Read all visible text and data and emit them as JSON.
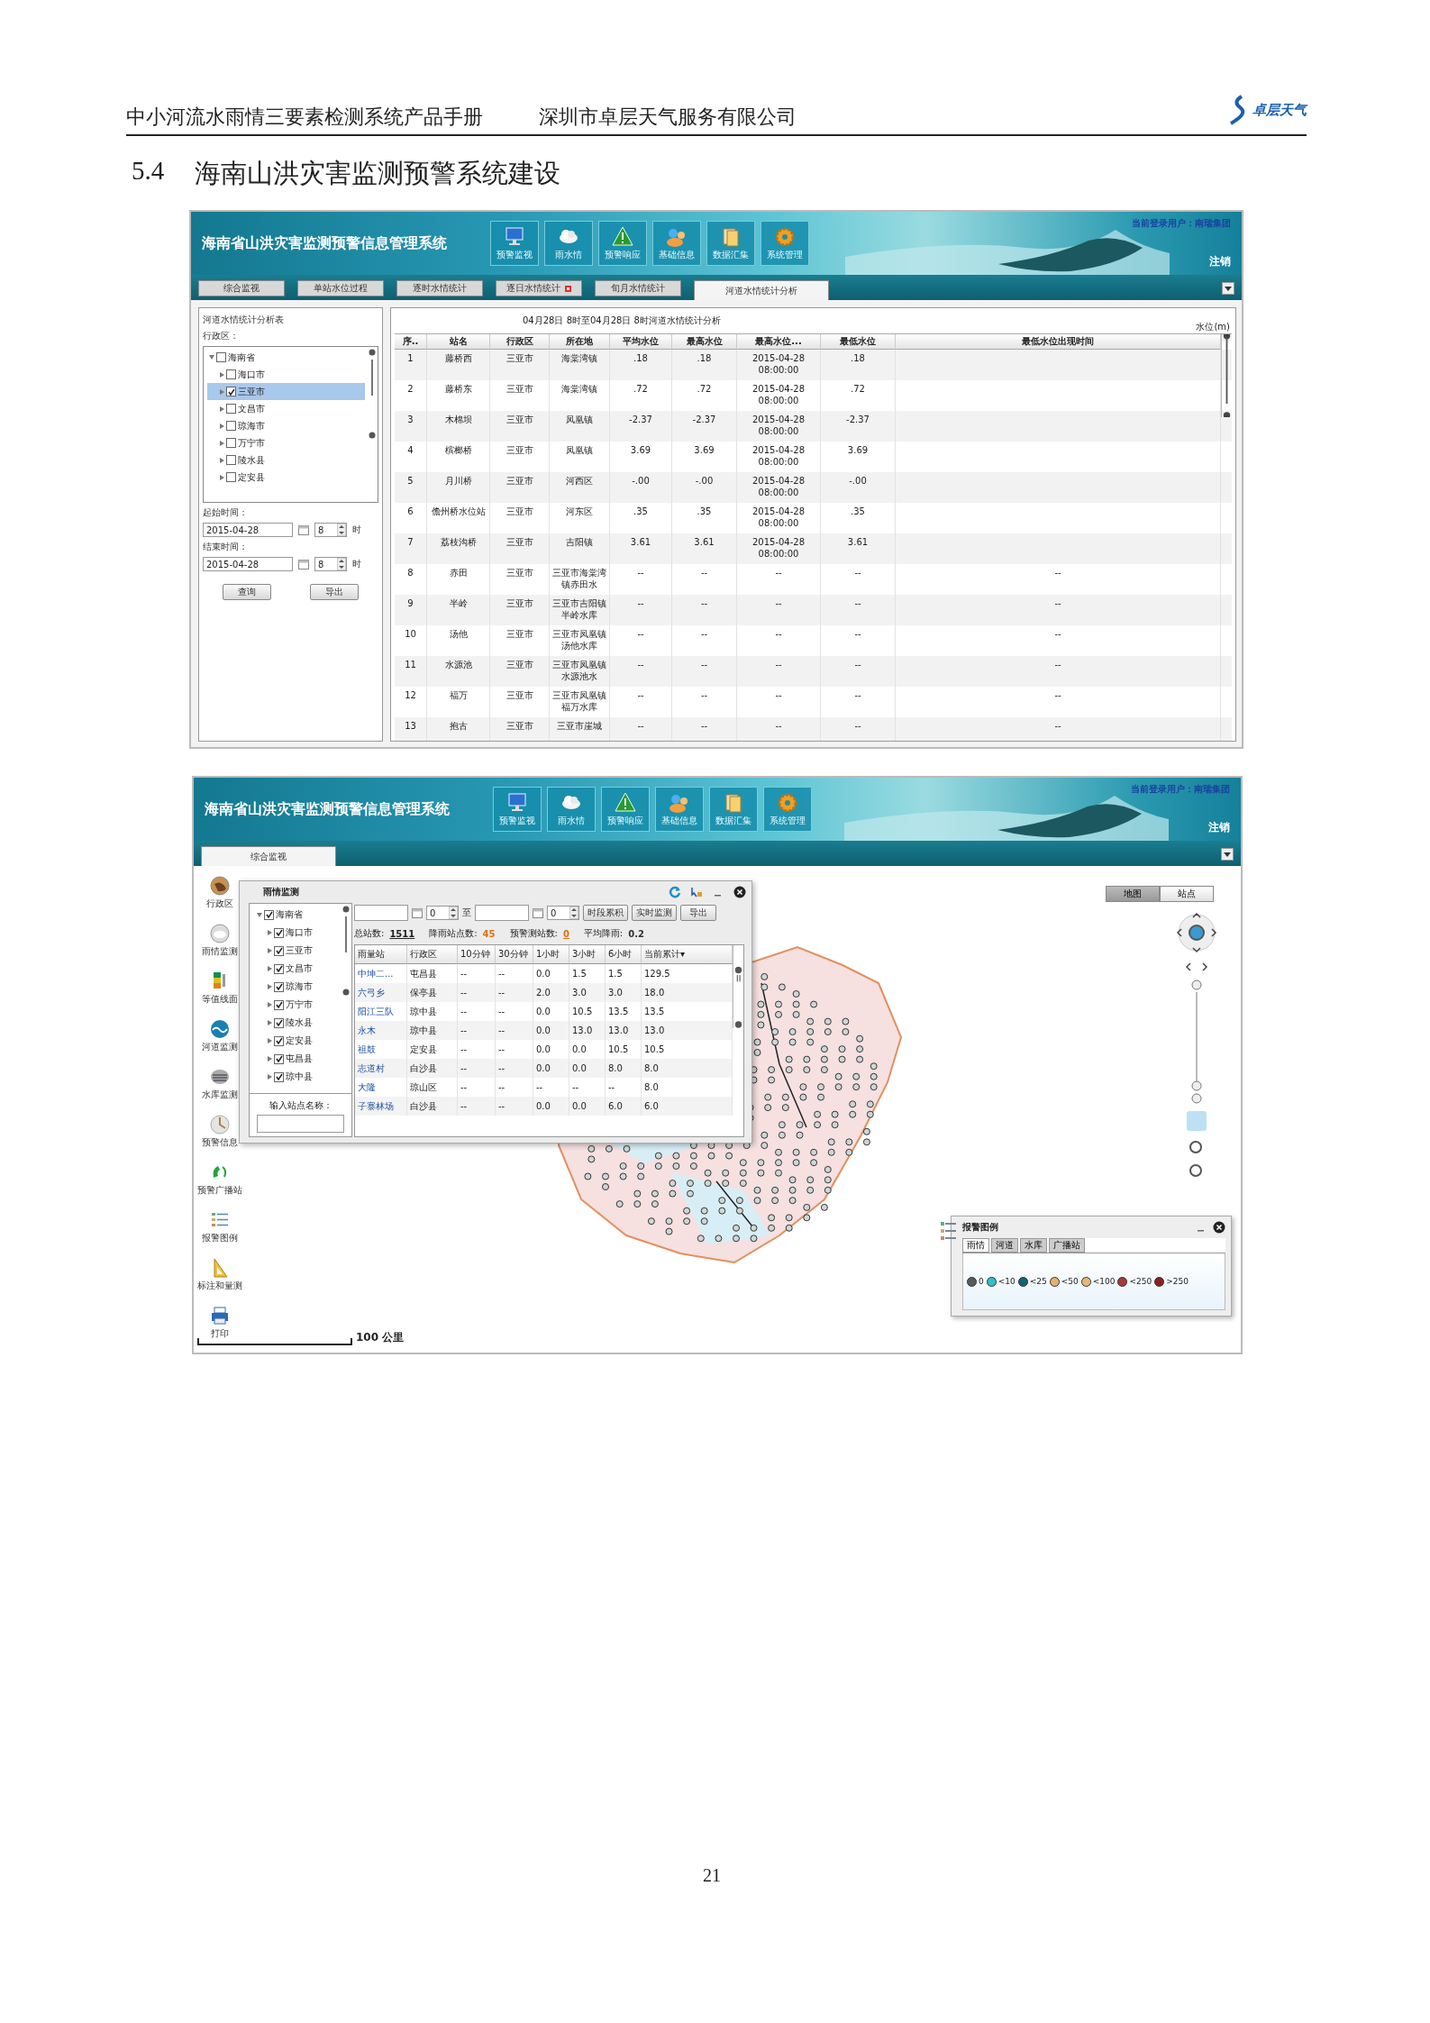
{
  "doc_header": {
    "title": "中小河流水雨情三要素检测系统产品手册",
    "company": "深圳市卓层天气服务有限公司",
    "logo_text": "卓层天气"
  },
  "section_heading": {
    "number": "5.4",
    "title": "海南山洪灾害监测预警系统建设"
  },
  "screen1": {
    "header": {
      "title": "海南省山洪灾害监测预警信息管理系统",
      "nav": [
        "预警监视",
        "雨水情",
        "预警响应",
        "基础信息",
        "数据汇集",
        "系统管理"
      ],
      "user": "当前登录用户：南瑞集团",
      "logout": "注销"
    },
    "tabs": [
      {
        "label": "综合监视",
        "selected": false,
        "alert": false
      },
      {
        "label": "单站水位过程",
        "selected": false,
        "alert": false
      },
      {
        "label": "逐时水情统计",
        "selected": false,
        "alert": false
      },
      {
        "label": "逐日水情统计",
        "selected": false,
        "alert": true
      },
      {
        "label": "旬月水情统计",
        "selected": false,
        "alert": false
      },
      {
        "label": "河道水情统计分析",
        "selected": true,
        "alert": false
      }
    ],
    "side_panel": {
      "title": "河道水情统计分析表",
      "region_label": "行政区：",
      "tree": [
        {
          "label": "海南省",
          "checked": false,
          "selected": false,
          "expanded": true,
          "children": [
            {
              "label": "海口市",
              "checked": false,
              "selected": false,
              "expanded": false
            },
            {
              "label": "三亚市",
              "checked": true,
              "selected": true,
              "expanded": false
            },
            {
              "label": "文昌市",
              "checked": false,
              "selected": false,
              "expanded": false
            },
            {
              "label": "琼海市",
              "checked": false,
              "selected": false,
              "expanded": false
            },
            {
              "label": "万宁市",
              "checked": false,
              "selected": false,
              "expanded": false
            },
            {
              "label": "陵水县",
              "checked": false,
              "selected": false,
              "expanded": false
            },
            {
              "label": "定安县",
              "checked": false,
              "selected": false,
              "expanded": false
            }
          ]
        }
      ],
      "start_label": "起始时间：",
      "start_date": "2015-04-28",
      "start_hour": "8",
      "hour_unit_1": "时",
      "end_label": "结束时间：",
      "end_date": "2015-04-28",
      "end_hour": "8",
      "hour_unit_2": "时",
      "buttons": [
        "查询",
        "导出"
      ]
    },
    "table": {
      "caption": "04月28日 8时至04月28日 8时河道水情统计分析",
      "unit": "水位(m)",
      "columns": [
        "序..",
        "站名",
        "行政区",
        "所在地",
        "平均水位",
        "最高水位",
        "最高水位...",
        "最低水位",
        "最低水位出现时间"
      ],
      "rows": [
        [
          "1",
          "藤桥西",
          "三亚市",
          "海棠湾镇",
          ".18",
          ".18",
          "2015-04-28 08:00:00",
          ".18",
          ""
        ],
        [
          "2",
          "藤桥东",
          "三亚市",
          "海棠湾镇",
          ".72",
          ".72",
          "2015-04-28 08:00:00",
          ".72",
          ""
        ],
        [
          "3",
          "木棉坝",
          "三亚市",
          "凤凰镇",
          "-2.37",
          "-2.37",
          "2015-04-28 08:00:00",
          "-2.37",
          ""
        ],
        [
          "4",
          "槟榔桥",
          "三亚市",
          "凤凰镇",
          "3.69",
          "3.69",
          "2015-04-28 08:00:00",
          "3.69",
          ""
        ],
        [
          "5",
          "月川桥",
          "三亚市",
          "河西区",
          "-.00",
          "-.00",
          "2015-04-28 08:00:00",
          "-.00",
          ""
        ],
        [
          "6",
          "儋州桥水位站",
          "三亚市",
          "河东区",
          ".35",
          ".35",
          "2015-04-28 08:00:00",
          ".35",
          ""
        ],
        [
          "7",
          "荔枝沟桥",
          "三亚市",
          "吉阳镇",
          "3.61",
          "3.61",
          "2015-04-28 08:00:00",
          "3.61",
          ""
        ],
        [
          "8",
          "赤田",
          "三亚市",
          "三亚市海棠湾镇赤田水",
          "--",
          "--",
          "--",
          "--",
          "--"
        ],
        [
          "9",
          "半岭",
          "三亚市",
          "三亚市吉阳镇半岭水库",
          "--",
          "--",
          "--",
          "--",
          "--"
        ],
        [
          "10",
          "汤他",
          "三亚市",
          "三亚市凤凰镇汤他水库",
          "--",
          "--",
          "--",
          "--",
          "--"
        ],
        [
          "11",
          "水源池",
          "三亚市",
          "三亚市凤凰镇水源池水",
          "--",
          "--",
          "--",
          "--",
          "--"
        ],
        [
          "12",
          "福万",
          "三亚市",
          "三亚市凤凰镇福万水库",
          "--",
          "--",
          "--",
          "--",
          "--"
        ],
        [
          "13",
          "抱古",
          "三亚市",
          "三亚市崖城",
          "--",
          "--",
          "--",
          "--",
          "--"
        ]
      ]
    }
  },
  "screen2": {
    "header": {
      "title": "海南省山洪灾害监测预警信息管理系统",
      "nav": [
        "预警监视",
        "雨水情",
        "预警响应",
        "基础信息",
        "数据汇集",
        "系统管理"
      ],
      "user": "当前登录用户：南瑞集团",
      "logout": "注销"
    },
    "tabs": [
      {
        "label": "综合监视",
        "selected": true,
        "alert": false
      }
    ],
    "toolbar": [
      "行政区",
      "雨情监测",
      "等值线面",
      "河道监测",
      "水库监测",
      "预警信息",
      "预警广播站",
      "报警图例",
      "标注和量测",
      "打印"
    ],
    "rain_window": {
      "title": "雨情监测",
      "tree": [
        {
          "label": "海南省",
          "checked": true,
          "expanded": true,
          "children": [
            {
              "label": "海口市",
              "checked": true,
              "expanded": false
            },
            {
              "label": "三亚市",
              "checked": true,
              "expanded": false
            },
            {
              "label": "文昌市",
              "checked": true,
              "expanded": false
            },
            {
              "label": "琼海市",
              "checked": true,
              "expanded": false
            },
            {
              "label": "万宁市",
              "checked": true,
              "expanded": false
            },
            {
              "label": "陵水县",
              "checked": true,
              "expanded": false
            },
            {
              "label": "定安县",
              "checked": true,
              "expanded": false
            },
            {
              "label": "屯昌县",
              "checked": true,
              "expanded": false
            },
            {
              "label": "琼中县",
              "checked": true,
              "expanded": false
            }
          ]
        }
      ],
      "station_label": "输入站点名称：",
      "from_hour": "0",
      "to_label": "至",
      "to_hour": "0",
      "buttons": [
        "时段累积",
        "实时监测",
        "导出"
      ],
      "stats": [
        {
          "label": "总站数:",
          "value": "1511"
        },
        {
          "label": "降雨站点数:",
          "value": "45"
        },
        {
          "label": "预警测站数:",
          "value": "0"
        },
        {
          "label": "平均降雨:",
          "value": "0.2"
        }
      ],
      "columns": [
        "雨量站",
        "行政区",
        "10分钟",
        "30分钟",
        "1小时",
        "3小时",
        "6小时",
        "当前累计▾"
      ],
      "rows": [
        [
          "中坤二...",
          "屯昌县",
          "--",
          "--",
          "0.0",
          "1.5",
          "1.5",
          "129.5"
        ],
        [
          "六弓乡",
          "保亭县",
          "--",
          "--",
          "2.0",
          "3.0",
          "3.0",
          "18.0"
        ],
        [
          "阳江三队",
          "琼中县",
          "--",
          "--",
          "0.0",
          "10.5",
          "13.5",
          "13.5"
        ],
        [
          "永木",
          "琼中县",
          "--",
          "--",
          "0.0",
          "13.0",
          "13.0",
          "13.0"
        ],
        [
          "祖鼓",
          "定安县",
          "--",
          "--",
          "0.0",
          "0.0",
          "10.5",
          "10.5"
        ],
        [
          "志道村",
          "白沙县",
          "--",
          "--",
          "0.0",
          "0.0",
          "8.0",
          "8.0"
        ],
        [
          "大隆",
          "琼山区",
          "--",
          "--",
          "--",
          "--",
          "--",
          "8.0"
        ],
        [
          "子寨林场",
          "白沙县",
          "--",
          "--",
          "0.0",
          "0.0",
          "6.0",
          "6.0"
        ]
      ]
    },
    "map_buttons": [
      {
        "label": "地图",
        "selected": true
      },
      {
        "label": "站点",
        "selected": false
      }
    ],
    "legend": {
      "title": "报警图例",
      "tabs": [
        {
          "label": "雨情",
          "selected": true
        },
        {
          "label": "河道",
          "selected": false
        },
        {
          "label": "水库",
          "selected": false
        },
        {
          "label": "广播站",
          "selected": false
        }
      ],
      "items": [
        {
          "label": "0",
          "color": "#5a5a5a"
        },
        {
          "label": "<10",
          "color": "#2cc0d0"
        },
        {
          "label": "<25",
          "color": "#0e6676"
        },
        {
          "label": "<50",
          "color": "#e6b070"
        },
        {
          "label": "<100",
          "color": "#e8b878"
        },
        {
          "label": "<250",
          "color": "#a83838"
        },
        {
          "label": ">250",
          "color": "#8e2020"
        }
      ]
    },
    "scale": "100 公里"
  },
  "page_number": "21"
}
